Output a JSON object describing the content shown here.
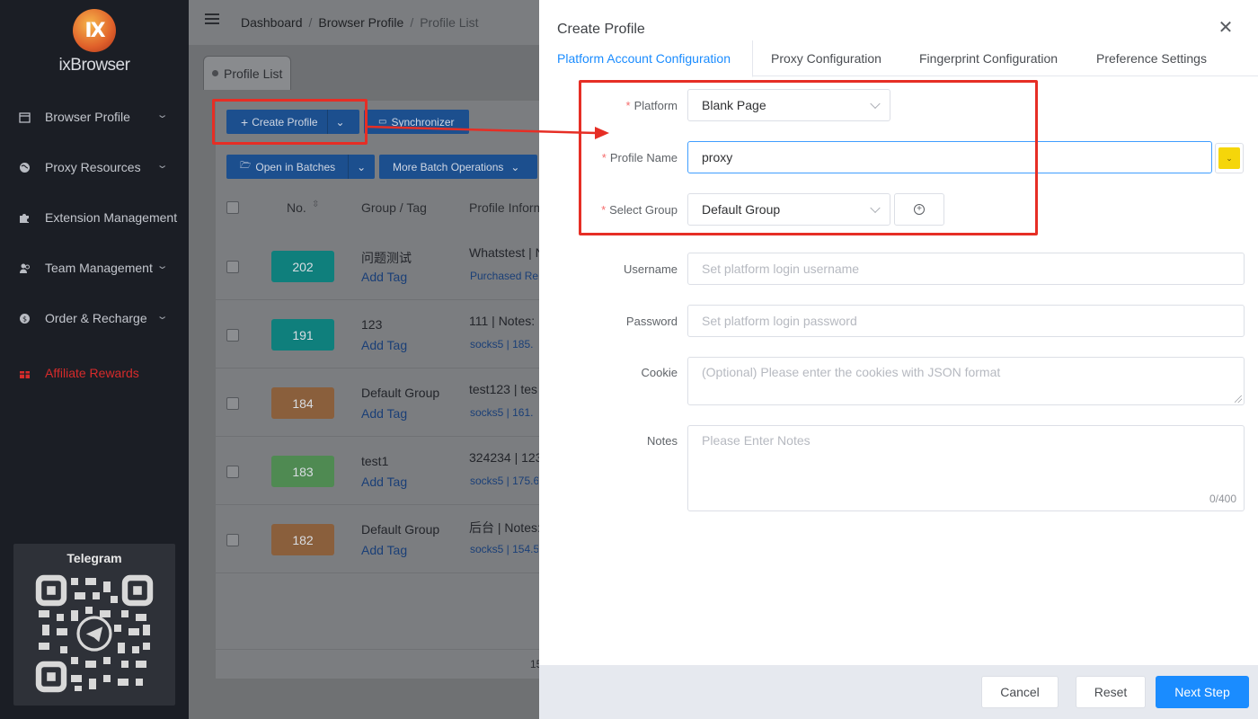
{
  "app": {
    "name": "ixBrowser",
    "logo_mark": "IX"
  },
  "sidebar": {
    "items": [
      {
        "label": "Browser Profile",
        "icon": "calendar-icon"
      },
      {
        "label": "Proxy Resources",
        "icon": "globe-icon"
      },
      {
        "label": "Extension Management",
        "icon": "puzzle-icon"
      },
      {
        "label": "Team Management",
        "icon": "users-icon"
      },
      {
        "label": "Order & Recharge",
        "icon": "dollar-icon"
      },
      {
        "label": "Affiliate Rewards",
        "icon": "gift-icon",
        "color": "#d62b2b"
      }
    ],
    "telegram_title": "Telegram"
  },
  "header": {
    "breadcrumb": [
      "Dashboard",
      "Browser Profile",
      "Profile List"
    ]
  },
  "tabs": {
    "active": "Profile List"
  },
  "toolbar": {
    "create_profile": "Create Profile",
    "synchronizer": "Synchronizer",
    "open_in_batches": "Open in Batches",
    "more_batch_operations": "More Batch Operations"
  },
  "table": {
    "columns": [
      "No.",
      "Group / Tag",
      "Profile Informe"
    ],
    "add_tag": "Add Tag",
    "rows": [
      {
        "no": "202",
        "color": "#0f7f7c",
        "group": "问题测试",
        "info": "Whatstest | N",
        "sub": "Purchased Re"
      },
      {
        "no": "191",
        "color": "#0f7f7c",
        "group": "123",
        "info": "111 | Notes:",
        "sub": "socks5 | 185."
      },
      {
        "no": "184",
        "color": "#8a5f3c",
        "group": "Default Group",
        "info": "test123 | tes",
        "sub": "socks5 | 161."
      },
      {
        "no": "183",
        "color": "#4f8a52",
        "group": "test1",
        "info": "324234 | 123",
        "sub": "socks5 | 175.6"
      },
      {
        "no": "182",
        "color": "#8a5f3c",
        "group": "Default Group",
        "info": "后台 | Notes:",
        "sub": "socks5 | 154.5"
      }
    ],
    "footer_partial": "15"
  },
  "drawer": {
    "title": "Create Profile",
    "tabs": [
      "Platform Account Configuration",
      "Proxy Configuration",
      "Fingerprint Configuration",
      "Preference Settings"
    ],
    "form": {
      "platform_label": "Platform",
      "platform_value": "Blank Page",
      "profile_name_label": "Profile Name",
      "profile_name_value": "proxy",
      "select_group_label": "Select Group",
      "select_group_value": "Default Group",
      "username_label": "Username",
      "username_placeholder": "Set platform login username",
      "password_label": "Password",
      "password_placeholder": "Set platform login password",
      "cookie_label": "Cookie",
      "cookie_placeholder": "(Optional) Please enter the cookies with JSON format",
      "notes_label": "Notes",
      "notes_placeholder": "Please Enter Notes",
      "notes_counter": "0/400"
    },
    "footer": {
      "cancel": "Cancel",
      "reset": "Reset",
      "next": "Next Step"
    }
  },
  "colors": {
    "accent": "#1a8cff",
    "highlight": "#e62e25",
    "swatch": "#f5d60a"
  }
}
